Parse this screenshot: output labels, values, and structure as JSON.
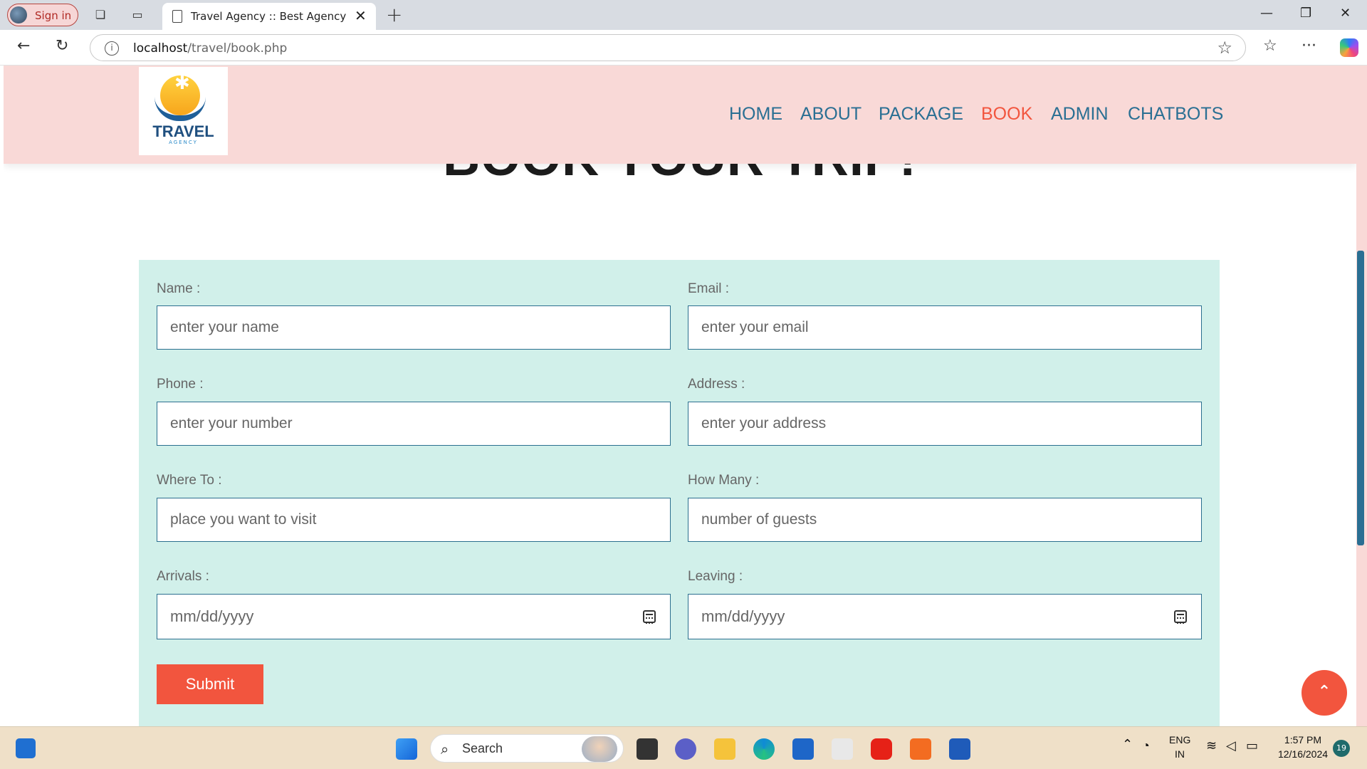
{
  "browser": {
    "signin_label": "Sign in",
    "tab_title": "Travel Agency :: Best Agency",
    "url_host": "localhost",
    "url_path": "/travel/book.php"
  },
  "site": {
    "logo_brand": "TRAVEL",
    "logo_sub": "AGENCY",
    "nav": [
      "HOME",
      "ABOUT",
      "PACKAGE",
      "BOOK",
      "ADMIN",
      "CHATBOTS"
    ],
    "active_nav": "BOOK",
    "heading": "BOOK YOUR TRIP!"
  },
  "form": {
    "name_label": "Name :",
    "name_placeholder": "enter your name",
    "email_label": "Email :",
    "email_placeholder": "enter your email",
    "phone_label": "Phone :",
    "phone_placeholder": "enter your number",
    "address_label": "Address :",
    "address_placeholder": "enter your address",
    "where_label": "Where To :",
    "where_placeholder": "place you want to visit",
    "guests_label": "How Many :",
    "guests_placeholder": "number of guests",
    "arrivals_label": "Arrivals :",
    "arrivals_placeholder": "mm/dd/yyyy",
    "leaving_label": "Leaving :",
    "leaving_placeholder": "mm/dd/yyyy",
    "submit_label": "Submit"
  },
  "taskbar": {
    "search_label": "Search",
    "lang_top": "ENG",
    "lang_bottom": "IN",
    "time": "1:57 PM",
    "date": "12/16/2024",
    "notification_count": "19"
  },
  "colors": {
    "header_bg": "#f9d9d7",
    "nav_color": "#2a6f93",
    "accent": "#f2553e",
    "form_bg": "#d1f0ea"
  }
}
